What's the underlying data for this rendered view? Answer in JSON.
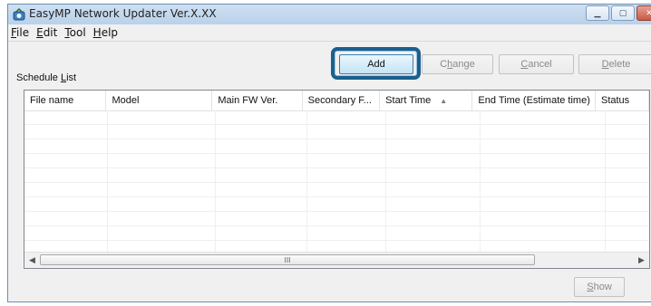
{
  "window": {
    "title": "EasyMP Network Updater Ver.X.XX"
  },
  "menu": [
    {
      "label": "File",
      "mnemonic": "F",
      "rest": "ile"
    },
    {
      "label": "Edit",
      "mnemonic": "E",
      "rest": "dit"
    },
    {
      "label": "Tool",
      "mnemonic": "T",
      "rest": "ool"
    },
    {
      "label": "Help",
      "mnemonic": "H",
      "rest": "elp"
    }
  ],
  "schedule": {
    "label_pre": "Schedule ",
    "label_ul": "L",
    "label_post": "ist"
  },
  "buttons": {
    "add": "Add",
    "change_pre": "C",
    "change_ul": "h",
    "change_post": "ange",
    "cancel_ul": "C",
    "cancel_post": "ancel",
    "delete_ul": "D",
    "delete_post": "elete",
    "show_ul": "S",
    "show_post": "how"
  },
  "table": {
    "columns": [
      "File name",
      "Model",
      "Main FW Ver.",
      "Secondary F...",
      "Start Time",
      "End Time (Estimate time)",
      "Status"
    ],
    "sorted_column": "Start Time",
    "scroll_grip": "III"
  },
  "colors": {
    "highlight": "#1b5f8f",
    "titlebar": "#b9d1ea"
  },
  "icons": {
    "app": "app-icon",
    "minimize": "minimize-icon",
    "maximize": "maximize-icon",
    "close": "close-icon"
  }
}
